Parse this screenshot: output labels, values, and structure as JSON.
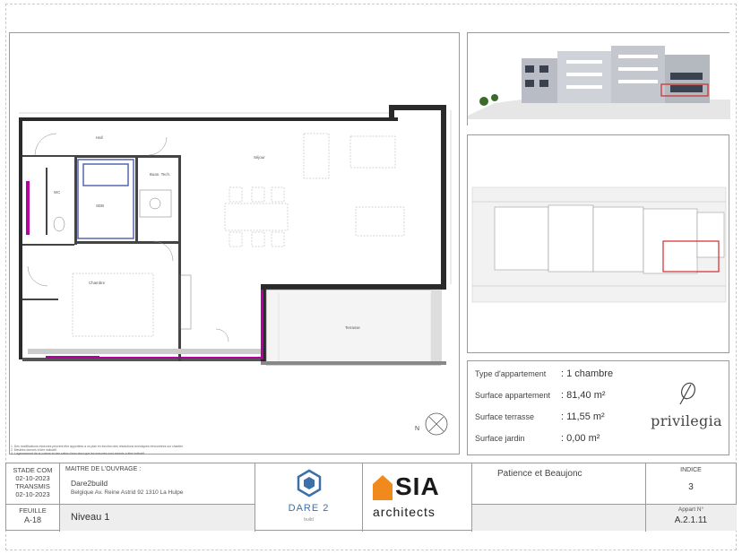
{
  "plan": {
    "rooms": {
      "hall": "Hall",
      "sejour": "Séjour",
      "sdb": "SDB",
      "wc": "WC",
      "buanderie": "Buan. Tech.",
      "chambre": "Chambre",
      "terrasse": "Terrasse"
    },
    "north_label": "N"
  },
  "notes": [
    "1. Des modifications mineures peuvent être apportées à ce plan en fonction des résolutions techniques rencontrées sur chantier.",
    "2. Meubles donnés à titre indicatif.",
    "3. L'agencement de la cuisine et des salles d'eau ainsi que les mesures sont donnés à titre indicatif."
  ],
  "info": {
    "rows": [
      {
        "label": "Type d'appartement",
        "value": ": 1 chambre"
      },
      {
        "label": "Surface appartement",
        "value": ": 81,40 m²"
      },
      {
        "label": "Surface terrasse",
        "value": ": 11,55 m²"
      },
      {
        "label": "Surface jardin",
        "value": ": 0,00 m²"
      }
    ],
    "brand": "privilegia"
  },
  "title_block": {
    "stade_label": "STADE COM",
    "stade_date": "02-10-2023",
    "transmis_label": "TRANSMIS",
    "transmis_date": "02-10-2023",
    "feuille_label": "FEUILLE",
    "feuille_value": "A-18",
    "maitre_label": "MAITRE DE L'OUVRAGE :",
    "maitre_name": "Dare2build",
    "maitre_address": "Belgique Av. Reine Astrid 92   1310 La Hulpe",
    "niveau": "Niveau 1",
    "dare_logo_text": "DARE 2",
    "dare_logo_sub": "build",
    "sia_logo_top": "SIA",
    "sia_logo_bottom": "architects",
    "project_name": "Patience et Beaujonc",
    "indice_label": "INDICE",
    "indice_value": "3",
    "appart_label": "Appart N°",
    "appart_value": "A.2.1.11"
  },
  "colors": {
    "magenta": "#b4009e",
    "highlight_red": "#d22a2a",
    "fixture_blue": "#4a5aa8",
    "sia_orange": "#f08a1c",
    "dare_blue": "#3d6fa8"
  }
}
